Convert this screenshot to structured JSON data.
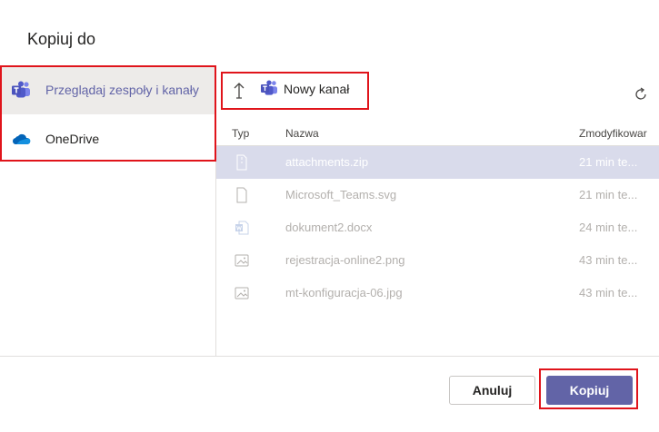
{
  "dialog": {
    "title": "Kopiuj do"
  },
  "sidebar": {
    "items": [
      {
        "label": "Przeglądaj zespoły i kanały",
        "icon": "teams-icon",
        "active": true
      },
      {
        "label": "OneDrive",
        "icon": "onedrive-icon",
        "active": false
      }
    ]
  },
  "toolbar": {
    "channel_label": "Nowy kanał"
  },
  "table": {
    "headers": {
      "type": "Typ",
      "name": "Nazwa",
      "modified": "Zmodyfikowar"
    },
    "rows": [
      {
        "icon": "zip-file-icon",
        "name": "attachments.zip",
        "modified": "21 min te...",
        "selected": true
      },
      {
        "icon": "generic-file-icon",
        "name": "Microsoft_Teams.svg",
        "modified": "21 min te...",
        "selected": false
      },
      {
        "icon": "word-doc-icon",
        "name": "dokument2.docx",
        "modified": "24 min te...",
        "selected": false
      },
      {
        "icon": "image-file-icon",
        "name": "rejestracja-online2.png",
        "modified": "43 min te...",
        "selected": false
      },
      {
        "icon": "image-file-icon",
        "name": "mt-konfiguracja-06.jpg",
        "modified": "43 min te...",
        "selected": false
      }
    ]
  },
  "footer": {
    "cancel_label": "Anuluj",
    "copy_label": "Kopiuj"
  },
  "colors": {
    "accent": "#6264a7",
    "highlight": "#e0141b",
    "selected_row": "#d9dbeb"
  }
}
